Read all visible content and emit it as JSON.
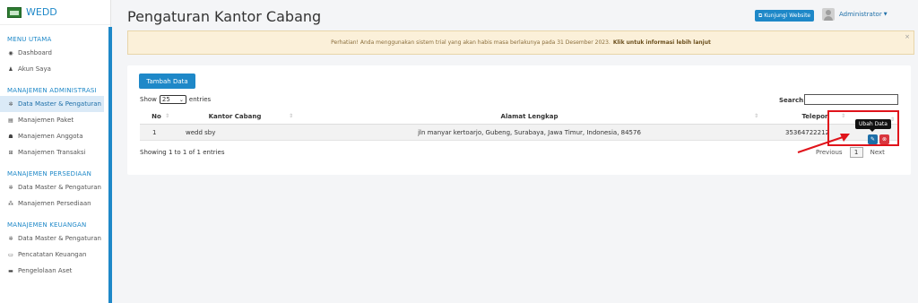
{
  "brand": {
    "name": "WEDD"
  },
  "sidebar": {
    "sections": [
      {
        "title": "MENU UTAMA",
        "items": [
          {
            "label": "Dashboard",
            "icon": "dashboard-icon",
            "glyph": "◉"
          },
          {
            "label": "Akun Saya",
            "icon": "user-icon",
            "glyph": "♟"
          }
        ]
      },
      {
        "title": "MANAJEMEN ADMINISTRASI",
        "items": [
          {
            "label": "Data Master & Pengaturan",
            "icon": "cogs-icon",
            "glyph": "✲",
            "active": true
          },
          {
            "label": "Manajemen Paket",
            "icon": "book-icon",
            "glyph": "▤"
          },
          {
            "label": "Manajemen Anggota",
            "icon": "users-icon",
            "glyph": "☗"
          },
          {
            "label": "Manajemen Transaksi",
            "icon": "cart-icon",
            "glyph": "⊞"
          }
        ]
      },
      {
        "title": "MANAJEMEN PERSEDIAAN",
        "items": [
          {
            "label": "Data Master & Pengaturan",
            "icon": "cogs-icon",
            "glyph": "✲"
          },
          {
            "label": "Manajemen Persediaan",
            "icon": "cubes-icon",
            "glyph": "⁂"
          }
        ]
      },
      {
        "title": "MANAJEMEN KEUANGAN",
        "items": [
          {
            "label": "Data Master & Pengaturan",
            "icon": "cogs-icon",
            "glyph": "✲"
          },
          {
            "label": "Pencatatan Keuangan",
            "icon": "money-icon",
            "glyph": "▭"
          },
          {
            "label": "Pengelolaan Aset",
            "icon": "laptop-icon",
            "glyph": "▬"
          }
        ]
      }
    ]
  },
  "header": {
    "title": "Pengaturan Kantor Cabang",
    "visit_label": "Kunjungi Website",
    "user_name": "Administrator"
  },
  "alert": {
    "text": "Perhatian! Anda menggunakan sistem trial yang akan habis masa berlakunya pada 31 Desember 2023.",
    "link": "Klik untuk informasi lebih lanjut",
    "close": "×"
  },
  "toolbar": {
    "add_label": "Tambah Data",
    "show_label": "Show",
    "entries_value": "25",
    "entries_label": "entries",
    "search_label": "Search:",
    "search_value": ""
  },
  "table": {
    "headers": [
      "No",
      "Kantor Cabang",
      "Alamat Lengkap",
      "Telepon",
      ""
    ],
    "rows": [
      {
        "no": "1",
        "kantor": "wedd sby",
        "alamat": "jln manyar kertoarjo, Gubeng, Surabaya, Jawa Timur, Indonesia, 84576",
        "telepon": "35364722212"
      }
    ],
    "tooltip": "Ubah Data"
  },
  "footer": {
    "info": "Showing 1 to 1 of 1 entries",
    "prev": "Previous",
    "page": "1",
    "next": "Next"
  },
  "colors": {
    "accent": "#1e88c8",
    "danger": "#d9363e",
    "annotation": "#e0141b",
    "alert_bg": "#fbf0d9"
  }
}
